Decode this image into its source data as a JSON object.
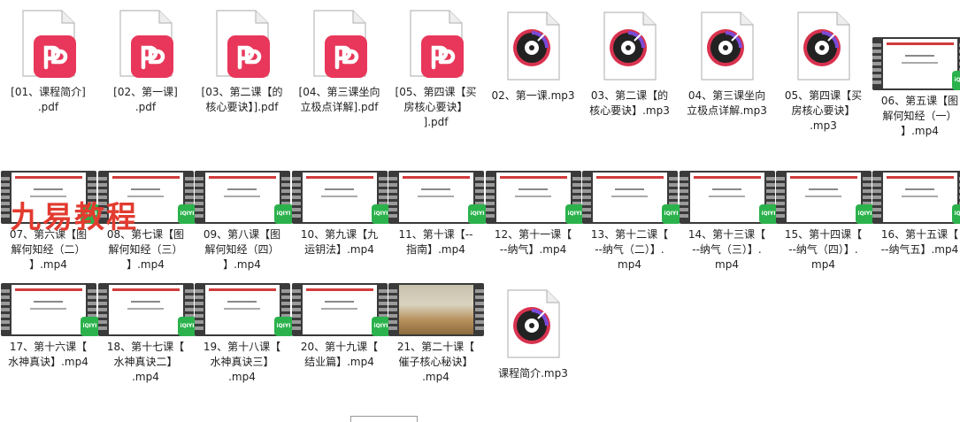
{
  "files": [
    {
      "type": "pdf",
      "label": "[01、课程简介]\n.pdf"
    },
    {
      "type": "pdf",
      "label": "[02、第一课]\n.pdf"
    },
    {
      "type": "pdf",
      "label": "[03、第二课【的\n核心要诀】].pdf"
    },
    {
      "type": "pdf",
      "label": "[04、第三课坐向\n立极点详解].pdf"
    },
    {
      "type": "pdf",
      "label": "[05、第四课【买\n房核心要诀】\n].pdf"
    },
    {
      "type": "mp3",
      "label": "02、第一课.mp3"
    },
    {
      "type": "mp3",
      "label": "03、第二课【的\n核心要诀】.mp3"
    },
    {
      "type": "mp3",
      "label": "04、第三课坐向\n立极点详解.mp3"
    },
    {
      "type": "mp3",
      "label": "05、第四课【买\n房核心要诀】\n.mp3"
    },
    {
      "type": "mp4",
      "label": "06、第五课【图\n解何知经（一）\n】.mp4"
    },
    {
      "type": "mp4",
      "label": "07、第六课【图\n解何知经（二）\n】.mp4"
    },
    {
      "type": "mp4",
      "label": "08、第七课【图\n解何知经（三）\n】.mp4"
    },
    {
      "type": "mp4",
      "label": "09、第八课【图\n解何知经（四）\n】.mp4"
    },
    {
      "type": "mp4",
      "label": "10、第九课【九\n运钥法】.mp4"
    },
    {
      "type": "mp4",
      "label": "11、第十课【--\n指南】.mp4"
    },
    {
      "type": "mp4",
      "label": "12、第十一课【\n--纳气】.mp4"
    },
    {
      "type": "mp4",
      "label": "13、第十二课【\n--纳气（二）】.\nmp4"
    },
    {
      "type": "mp4",
      "label": "14、第十三课【\n--纳气（三）】.\nmp4"
    },
    {
      "type": "mp4",
      "label": "15、第十四课【\n--纳气（四）】.\nmp4"
    },
    {
      "type": "mp4",
      "label": "16、第十五课【\n--纳气五】.mp4"
    },
    {
      "type": "mp4",
      "label": "17、第十六课【\n水神真诀】.mp4"
    },
    {
      "type": "mp4",
      "label": "18、第十七课【\n水神真诀二】\n.mp4"
    },
    {
      "type": "mp4",
      "label": "19、第十八课【\n水神真诀三】\n.mp4"
    },
    {
      "type": "mp4",
      "label": "20、第十九课【\n结业篇】.mp4"
    },
    {
      "type": "mp4",
      "thumb": "photo",
      "label": "21、第二十课【\n催子核心秘诀】\n.mp4"
    },
    {
      "type": "mp3",
      "label": "课程简介.mp3"
    }
  ],
  "watermark": "九易教程",
  "iqiyi_badge": "iQIYI",
  "colors": {
    "pdf": "#e8375a",
    "mp3_disc": "#d8324f",
    "iqiyi": "#2bb24c",
    "watermark": "#e23b2f"
  }
}
